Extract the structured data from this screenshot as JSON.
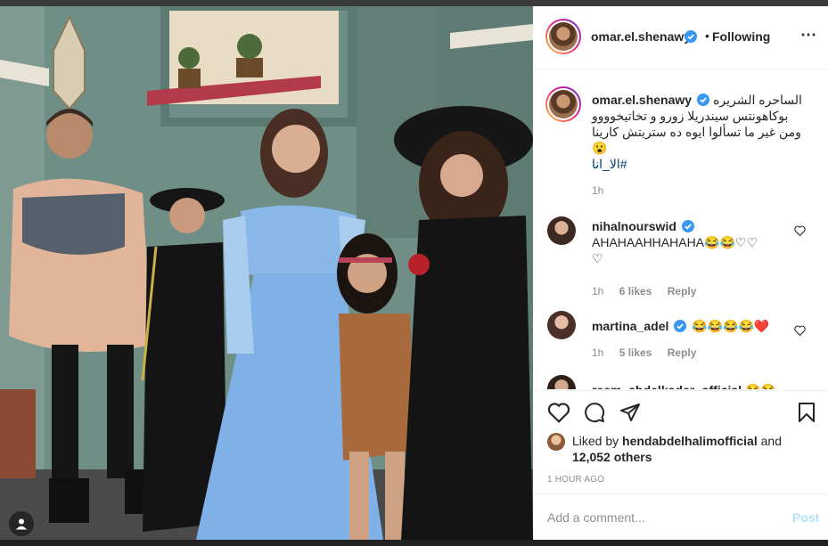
{
  "colors": {
    "verified": "#3897f0",
    "link": "#00376b",
    "meta": "#8e8e8e",
    "post_disabled": "#b2dffc",
    "heart_red": "#ed4956"
  },
  "post": {
    "author": "omar.el.shenawy",
    "follow_state": "Following",
    "separator": "•",
    "more_icon": "⋯"
  },
  "caption": {
    "username": "omar.el.shenawy",
    "line1": "الساحره الشريره",
    "line2": "بوكاهونتس سيندريلا زورو و تخاتيخوووو",
    "line3": "ومن غير ما تسألوا ايوه ده ستريتش كارينا",
    "emoji": "😮",
    "hashtag": "#الا_انا",
    "time": "1h"
  },
  "comments": [
    {
      "username": "nihalnourswid",
      "text": "AHAHAAHHAHAHA😂😂♡♡",
      "text2": "♡",
      "time": "1h",
      "likes": "6 likes",
      "reply": "Reply"
    },
    {
      "username": "martina_adel",
      "text": "😂😂😂😂❤️",
      "time": "1h",
      "likes": "5 likes",
      "reply": "Reply"
    },
    {
      "username": "reem_abdelkader_official",
      "text": "😂😂"
    }
  ],
  "likes": {
    "prefix": "Liked by",
    "user": "hendabdelhalimofficial",
    "and": "and",
    "count": "12,052 others"
  },
  "time_ago": "1 HOUR AGO",
  "add_comment": {
    "placeholder": "Add a comment...",
    "post_label": "Post"
  },
  "icons": [
    "heart-icon",
    "comment-icon",
    "share-icon",
    "bookmark-icon",
    "user-tag-icon",
    "verified-icon",
    "more-options-icon"
  ]
}
